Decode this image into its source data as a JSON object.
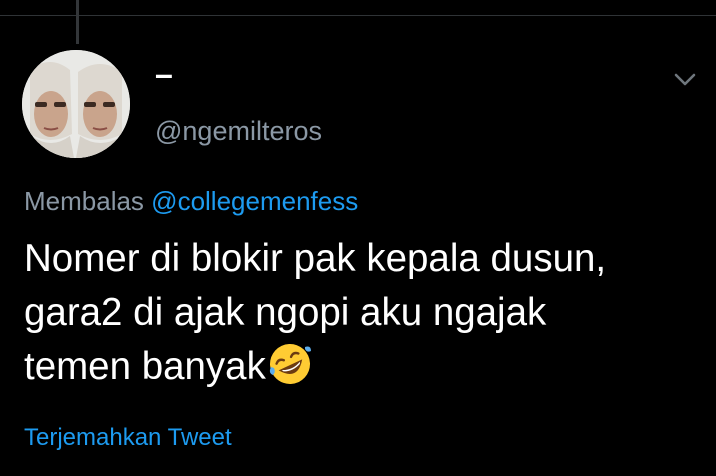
{
  "tweet": {
    "display_name": "–",
    "handle": "@ngemilteros",
    "reply_prefix": "Membalas",
    "reply_to": "@collegemenfess",
    "text_lines": [
      "Nomer di blokir pak kepala dusun,",
      "gara2 di ajak ngopi aku ngajak",
      "temen banyak"
    ],
    "emoji": "rolling-on-the-floor-laughing-emoji",
    "translate_label": "Terjemahkan Tweet"
  },
  "icons": {
    "menu": "chevron-down-icon"
  },
  "colors": {
    "background": "#000000",
    "text": "#ffffff",
    "secondary_text": "#8b98a5",
    "link": "#1d9bf0",
    "divider": "#2f3336"
  }
}
